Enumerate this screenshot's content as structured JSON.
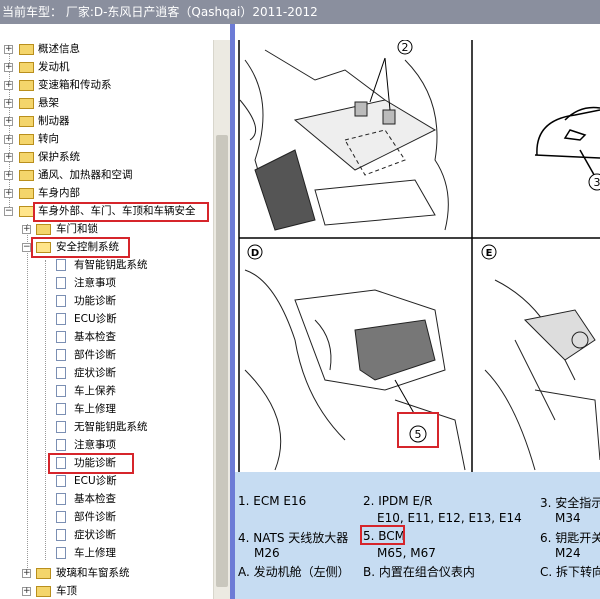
{
  "window": {
    "title": "当前车型： 厂家:D-东风日产逍客（Qashqai）2011-2012"
  },
  "tree": {
    "nodes": [
      {
        "label": "概述信息"
      },
      {
        "label": "发动机"
      },
      {
        "label": "变速箱和传动系"
      },
      {
        "label": "悬架"
      },
      {
        "label": "制动器"
      },
      {
        "label": "转向"
      },
      {
        "label": "保护系统"
      },
      {
        "label": "通风、加热器和空调"
      },
      {
        "label": "车身内部"
      },
      {
        "label": "车身外部、车门、车顶和车辆安全"
      },
      {
        "label": "车门和锁"
      },
      {
        "label": "安全控制系统"
      },
      {
        "label": "有智能钥匙系统"
      },
      {
        "label": "注意事项"
      },
      {
        "label": "功能诊断"
      },
      {
        "label": "ECU诊断"
      },
      {
        "label": "基本检查"
      },
      {
        "label": "部件诊断"
      },
      {
        "label": "症状诊断"
      },
      {
        "label": "车上保养"
      },
      {
        "label": "车上修理"
      },
      {
        "label": "无智能钥匙系统"
      },
      {
        "label": "注意事项"
      },
      {
        "label": "功能诊断"
      },
      {
        "label": "ECU诊断"
      },
      {
        "label": "基本检查"
      },
      {
        "label": "部件诊断"
      },
      {
        "label": "症状诊断"
      },
      {
        "label": "车上修理"
      },
      {
        "label": "玻璃和车窗系统"
      },
      {
        "label": "车顶"
      }
    ]
  },
  "diagram": {
    "callouts": [
      "2",
      "3",
      "5"
    ],
    "panels": [
      "D",
      "E"
    ]
  },
  "legend": {
    "items": [
      {
        "text": "1. ECM E16"
      },
      {
        "text": "2. IPDM E/R"
      },
      {
        "text": "E10, E11, E12, E13, E14"
      },
      {
        "text": "3. 安全指示"
      },
      {
        "text": "M34"
      },
      {
        "text": "4. NATS 天线放大器"
      },
      {
        "text": "M26"
      },
      {
        "text": "5. BCM"
      },
      {
        "text": "M65, M67"
      },
      {
        "text": "6. 钥匙开关"
      },
      {
        "text": "M24"
      },
      {
        "text": "A. 发动机舱（左侧）"
      },
      {
        "text": "B. 内置在组合仪表内"
      },
      {
        "text": "C. 拆下转向"
      }
    ]
  },
  "colors": {
    "highlight": "#d6252b",
    "legend_bg": "#c6dcf2",
    "splitter": "#6c7bd6",
    "titlebar": "#8a8f9e"
  }
}
